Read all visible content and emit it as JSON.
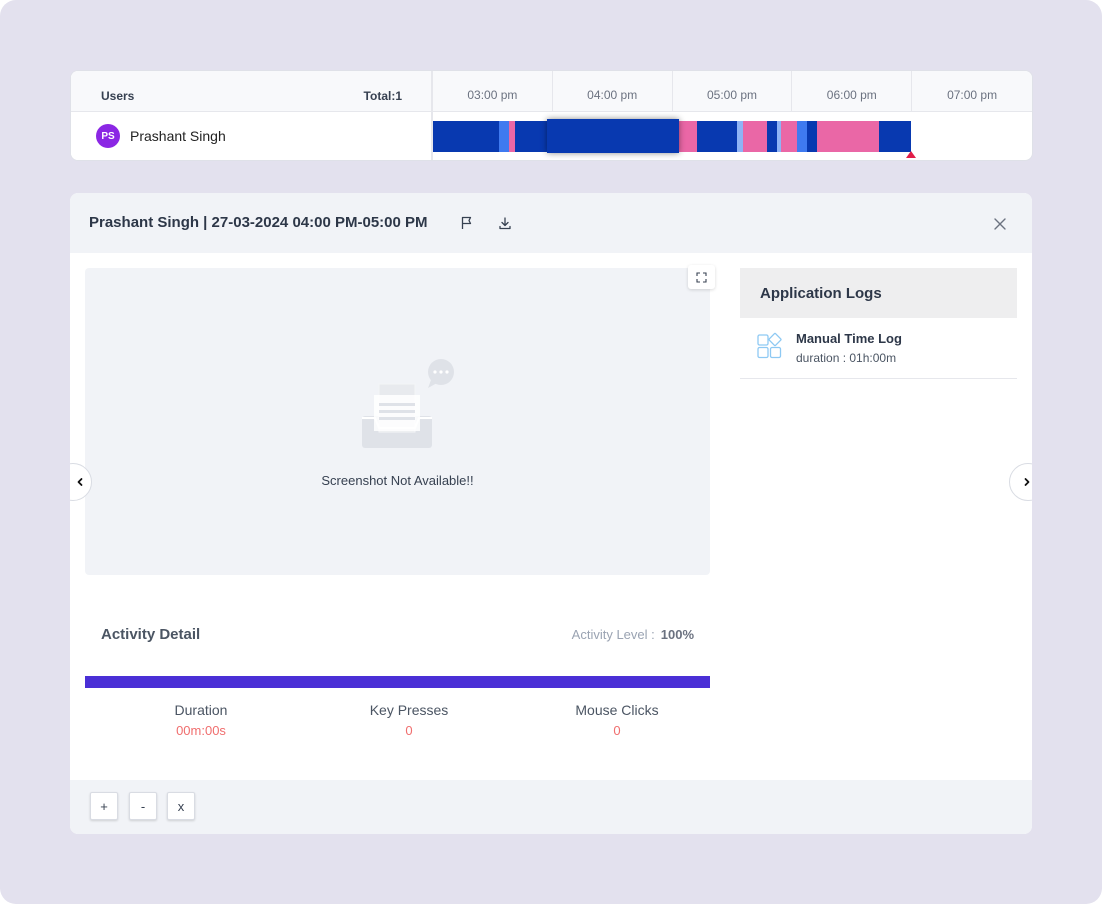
{
  "timeline": {
    "users_label": "Users",
    "total_label": "Total:1",
    "hours": [
      "03:00 pm",
      "04:00 pm",
      "05:00 pm",
      "06:00 pm",
      "07:00 pm"
    ],
    "user": {
      "initials": "PS",
      "name": "Prashant Singh"
    },
    "colors": {
      "active": "#0839b0",
      "idle": "#ea67a6",
      "light": "#3f7af0",
      "pale": "#8fb3f5",
      "marker": "#e11d48"
    }
  },
  "panel": {
    "title": "Prashant Singh | 27-03-2024 04:00 PM-05:00 PM",
    "screenshot_message": "Screenshot Not Available!!",
    "activity": {
      "title": "Activity Detail",
      "level_label": "Activity Level :",
      "level_value": "100%",
      "level_fraction": 1.0,
      "stats": [
        {
          "label": "Duration",
          "value": "00m:00s"
        },
        {
          "label": "Key Presses",
          "value": "0"
        },
        {
          "label": "Mouse Clicks",
          "value": "0"
        }
      ]
    },
    "app_logs": {
      "title": "Application Logs",
      "items": [
        {
          "name": "Manual Time Log",
          "duration": "duration : 01h:00m"
        }
      ]
    },
    "zoom": {
      "in": "+",
      "out": "-",
      "reset": "x"
    }
  }
}
